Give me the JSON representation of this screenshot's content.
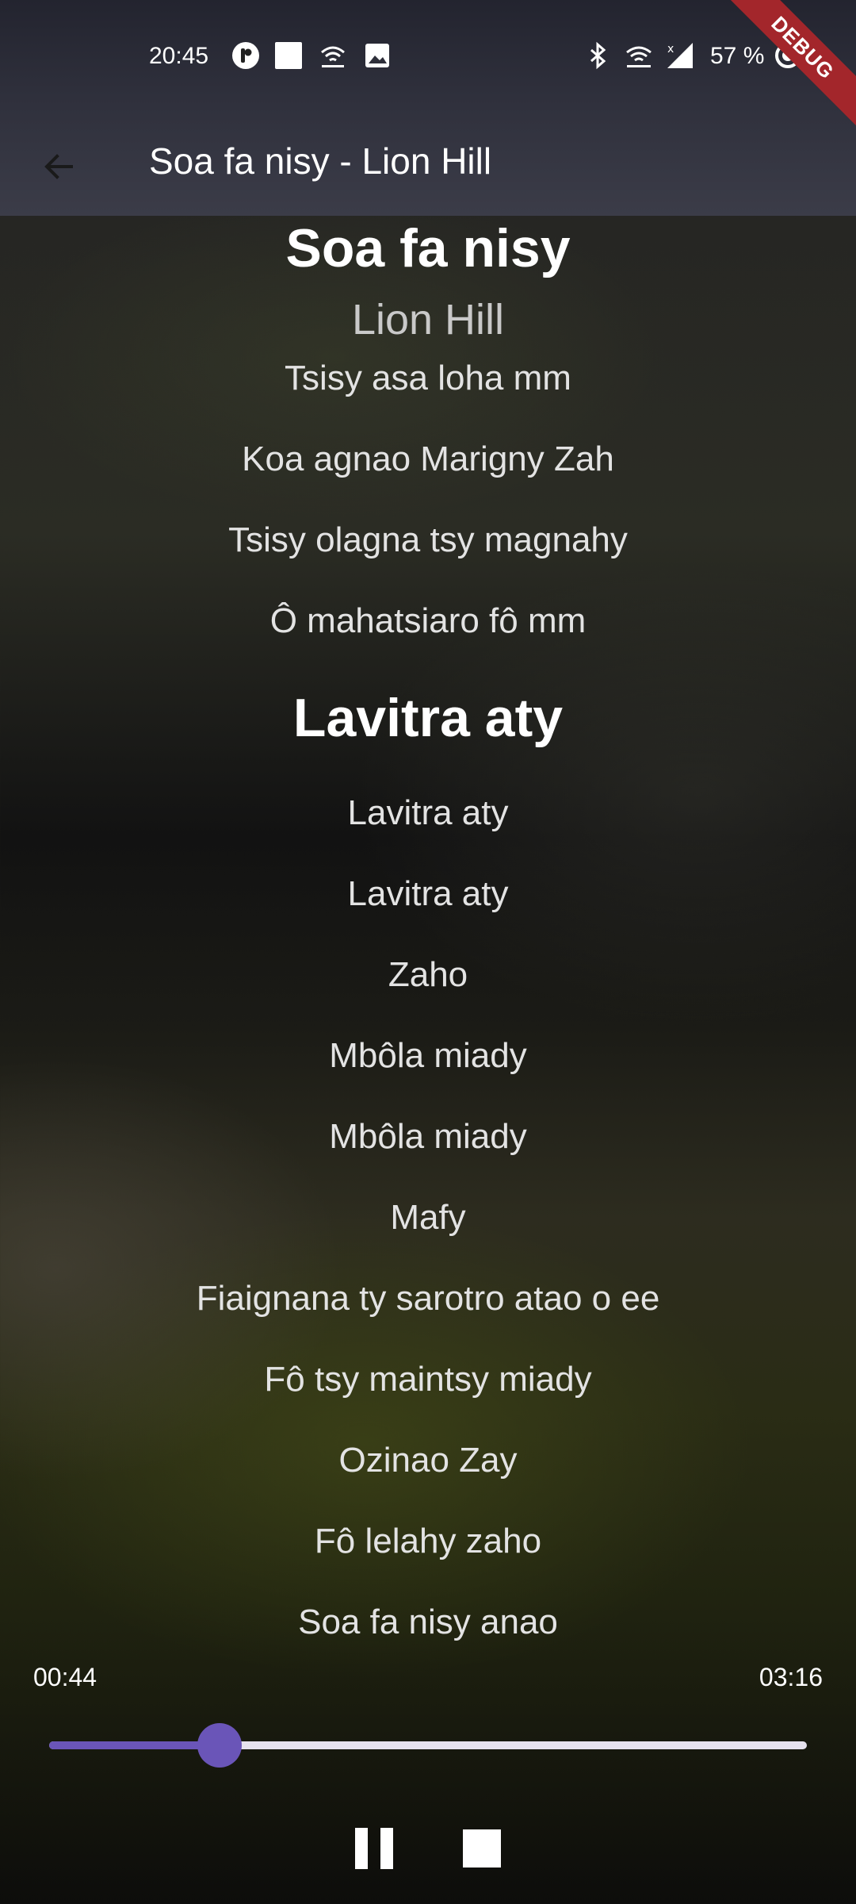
{
  "status_bar": {
    "time": "20:45",
    "battery": "57 %",
    "left_icons": [
      "app-icon",
      "square-icon",
      "wifi-calling-icon",
      "image-icon"
    ],
    "right_icons": [
      "bluetooth-icon",
      "wifi-icon",
      "signal-icon",
      "battery-icon"
    ]
  },
  "debug_banner": "DEBUG",
  "app_bar": {
    "title": "Soa fa nisy - Lion Hill",
    "back_icon": "arrow-back-icon"
  },
  "song": {
    "title": "Soa fa nisy",
    "artist": "Lion Hill"
  },
  "lyrics_block1": [
    "Tsisy asa loha  mm",
    "Koa agnao Marigny Zah",
    "Tsisy olagna tsy magnahy",
    "Ô mahatsiaro fô mm"
  ],
  "section_title": "Lavitra aty",
  "lyrics_block2": [
    "Lavitra aty",
    "Lavitra aty",
    "Zaho",
    "Mbôla miady",
    "Mbôla miady",
    "Mafy",
    "Fiaignana ty sarotro atao o ee",
    "Fô tsy maintsy miady",
    "Ozinao Zay",
    "Fô lelahy zaho",
    "Soa fa nisy anao"
  ],
  "player": {
    "elapsed": "00:44",
    "duration": "03:16",
    "progress": 0.2245,
    "accent_color": "#6a55b8",
    "track_color": "#e6e2ee",
    "pause_icon": "pause-icon",
    "stop_icon": "stop-icon"
  }
}
